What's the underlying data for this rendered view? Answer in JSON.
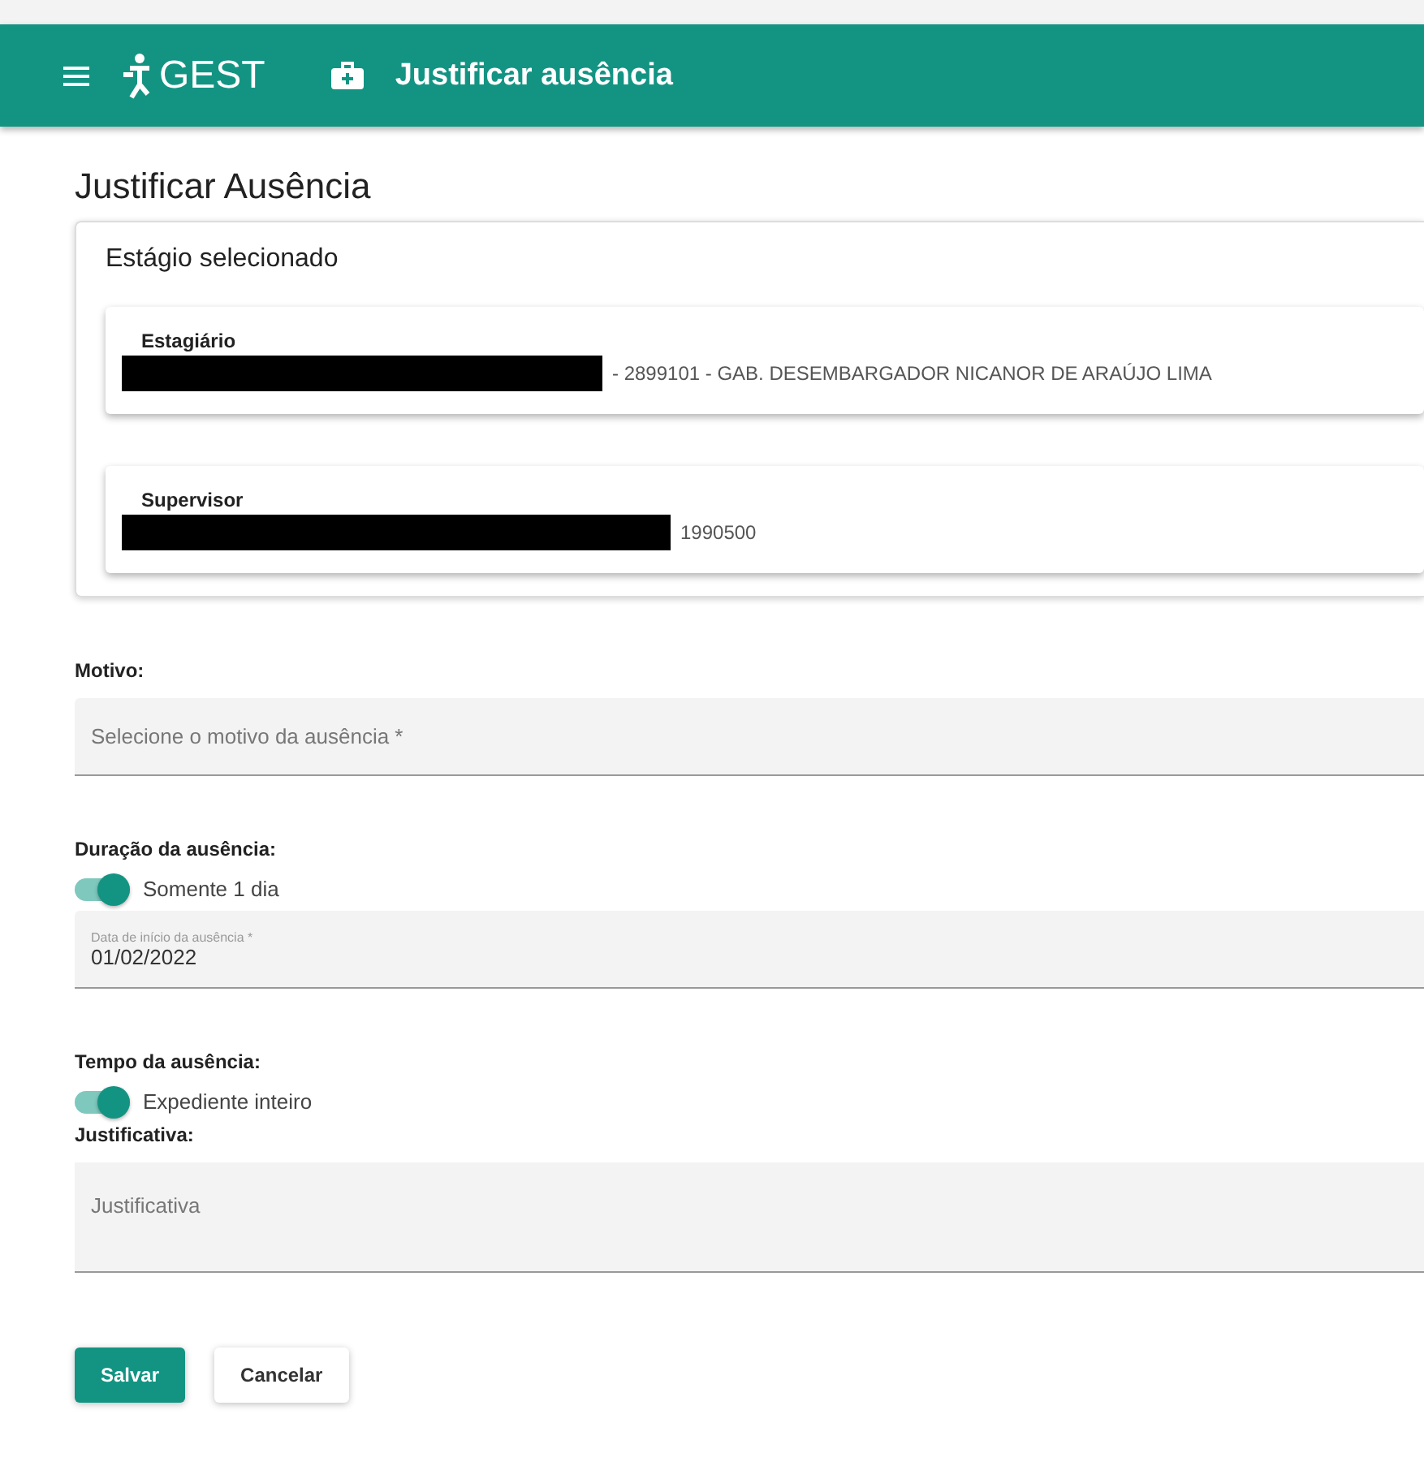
{
  "header": {
    "logo": "GEST",
    "title": "Justificar ausência"
  },
  "page_title": "Justificar Ausência",
  "stage": {
    "title": "Estágio selecionado",
    "people": [
      {
        "label": "Estagiário",
        "value": "- 2899101 - GAB. DESEMBARGADOR NICANOR DE ARAÚJO LIMA"
      },
      {
        "label": "Supervisor",
        "value": "1990500"
      }
    ]
  },
  "motivo": {
    "label": "Motivo:",
    "placeholder": "Selecione o motivo da ausência *"
  },
  "duracao": {
    "label": "Duração da ausência:",
    "toggle": {
      "label": "Somente 1 dia",
      "on": true
    },
    "date_field": {
      "label": "Data de início da ausência *",
      "value": "01/02/2022"
    }
  },
  "tempo": {
    "label": "Tempo da ausência:",
    "toggle": {
      "label": "Expediente inteiro",
      "on": true
    }
  },
  "justificativa": {
    "label": "Justificativa:",
    "placeholder": "Justificativa"
  },
  "buttons": [
    {
      "label": "Salvar",
      "kind": "primary"
    },
    {
      "label": "Cancelar",
      "kind": "secondary"
    }
  ]
}
